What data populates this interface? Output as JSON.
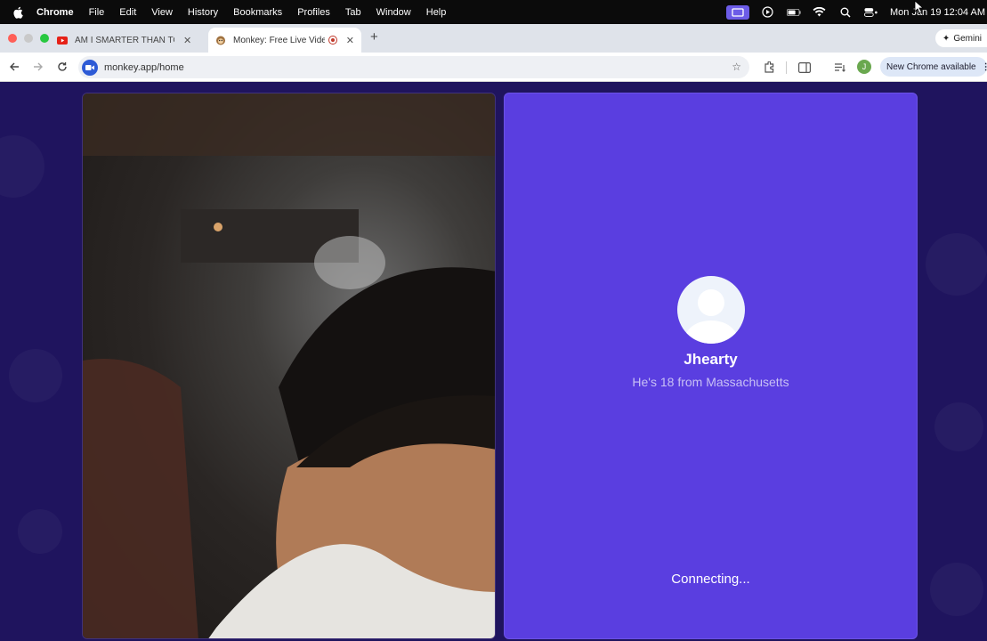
{
  "menubar": {
    "app_name": "Chrome",
    "menus": [
      "File",
      "Edit",
      "View",
      "History",
      "Bookmarks",
      "Profiles",
      "Tab",
      "Window",
      "Help"
    ],
    "clock": "Mon Jan 19  12:04 AM"
  },
  "tabs": [
    {
      "title": "AM I SMARTER THAN TOGI?",
      "icon": "youtube-icon",
      "active": false
    },
    {
      "title": "Monkey: Free Live Video Chat",
      "icon": "monkey-icon",
      "active": true
    }
  ],
  "gemini_label": "Gemini",
  "address_bar": {
    "url": "monkey.app/home"
  },
  "update_button_label": "New Chrome available",
  "profile_initial": "J",
  "partner": {
    "name": "Jhearty",
    "subtitle": "He's 18 from Massachusetts",
    "status": "Connecting..."
  },
  "colors": {
    "page_background": "#1f145e",
    "partner_panel": "#5a3ee0",
    "brand_accent": "#6c5ce7"
  }
}
